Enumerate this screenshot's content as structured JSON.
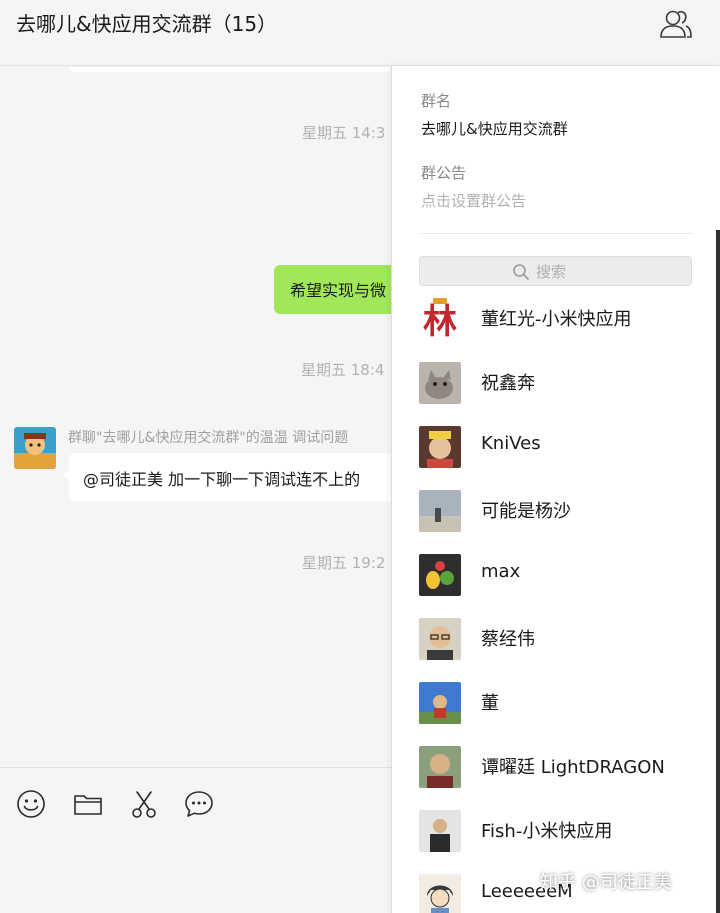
{
  "header": {
    "title": "去哪儿&快应用交流群（15）",
    "members_icon": "members-icon"
  },
  "chat": {
    "timestamps": [
      "星期五 14:3",
      "星期五 18:4",
      "星期五 19:2"
    ],
    "outgoing_message": "希望实现与微",
    "incoming": {
      "sender_line": "群聊\"去哪儿&快应用交流群\"的温温 调试问题",
      "message": "@司徒正美 加一下聊一下调试连不上的"
    }
  },
  "composer": {
    "tools": [
      "emoji-icon",
      "folder-icon",
      "scissors-icon",
      "chat-bubble-icon"
    ]
  },
  "panel": {
    "group_name_label": "群名",
    "group_name": "去哪儿&快应用交流群",
    "announcement_label": "群公告",
    "announcement_placeholder": "点击设置群公告",
    "search_placeholder": "搜索",
    "members": [
      {
        "name": "董红光-小米快应用",
        "color": "#c0262d"
      },
      {
        "name": "祝鑫奔",
        "color": "#9a9590"
      },
      {
        "name": "KniVes",
        "color": "#6e4a3a"
      },
      {
        "name": "可能是杨沙",
        "color": "#8a8f96"
      },
      {
        "name": "max",
        "color": "#3d3d3d"
      },
      {
        "name": "蔡经伟",
        "color": "#8a7a5e"
      },
      {
        "name": "董",
        "color": "#3e7bd0"
      },
      {
        "name": "谭曜廷 LightDRAGON",
        "color": "#5d6d52"
      },
      {
        "name": "Fish-小米快应用",
        "color": "#cfcfcf"
      },
      {
        "name": "LeeeeeeM",
        "color": "#e9d9c4"
      }
    ]
  },
  "watermark": "知乎 @司徒正美"
}
